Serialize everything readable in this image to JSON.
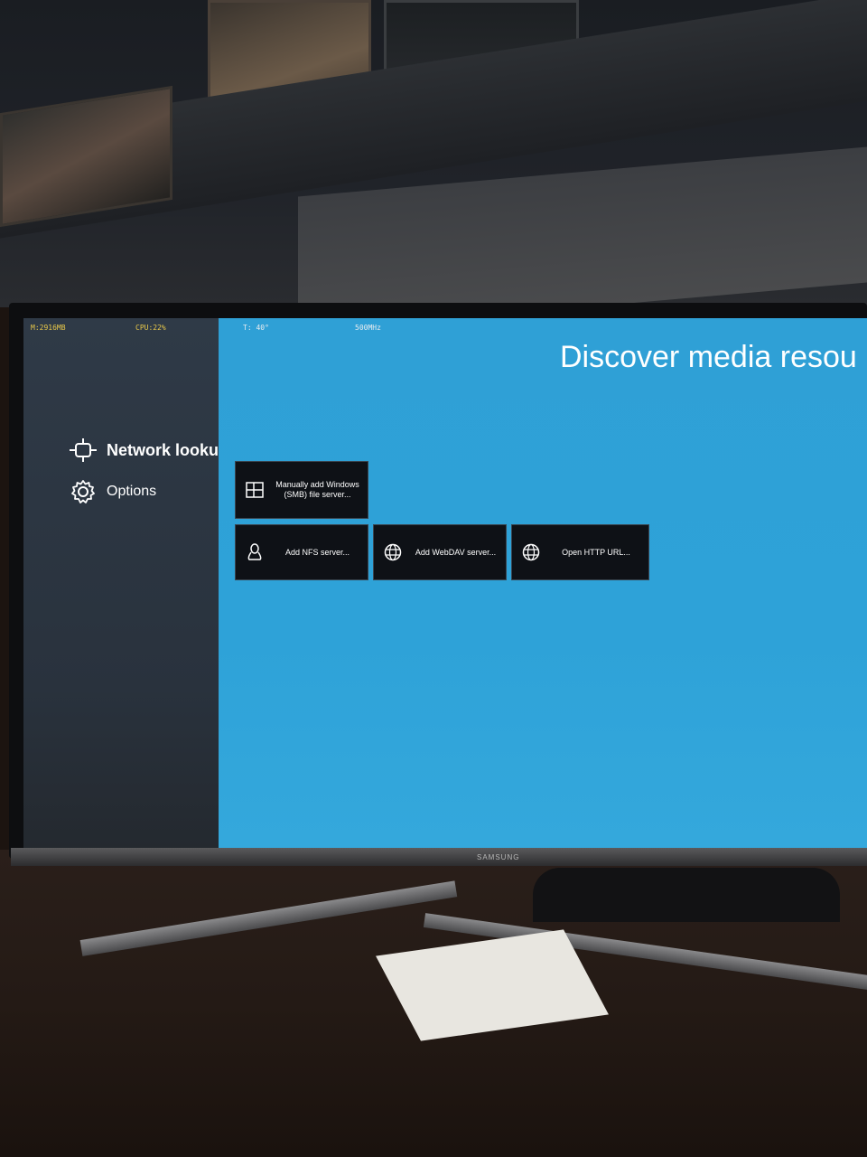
{
  "screen": {
    "status_bar": {
      "memory": "M:2916MB",
      "cpu": "CPU:22%",
      "temperature": "T: 40°",
      "frequency": "500MHz"
    },
    "heading": "Discover media resou",
    "sidebar": {
      "items": [
        {
          "label": "Network lookup",
          "icon": "network-icon",
          "active": true
        },
        {
          "label": "Options",
          "icon": "gear-icon",
          "active": false
        }
      ]
    },
    "tiles": [
      {
        "label": "Manually add Windows (SMB) file server...",
        "icon": "windows-icon"
      },
      {
        "label": "Add NFS server...",
        "icon": "linux-icon"
      },
      {
        "label": "Add WebDAV server...",
        "icon": "globe-icon"
      },
      {
        "label": "Open HTTP URL...",
        "icon": "globe-icon"
      }
    ]
  },
  "tv": {
    "brand": "SAMSUNG"
  },
  "colors": {
    "main_background": "#2fa0d6",
    "sidebar_background": "#2b3540",
    "tile_background": "#0e1116",
    "status_accent": "#e8c84a"
  }
}
